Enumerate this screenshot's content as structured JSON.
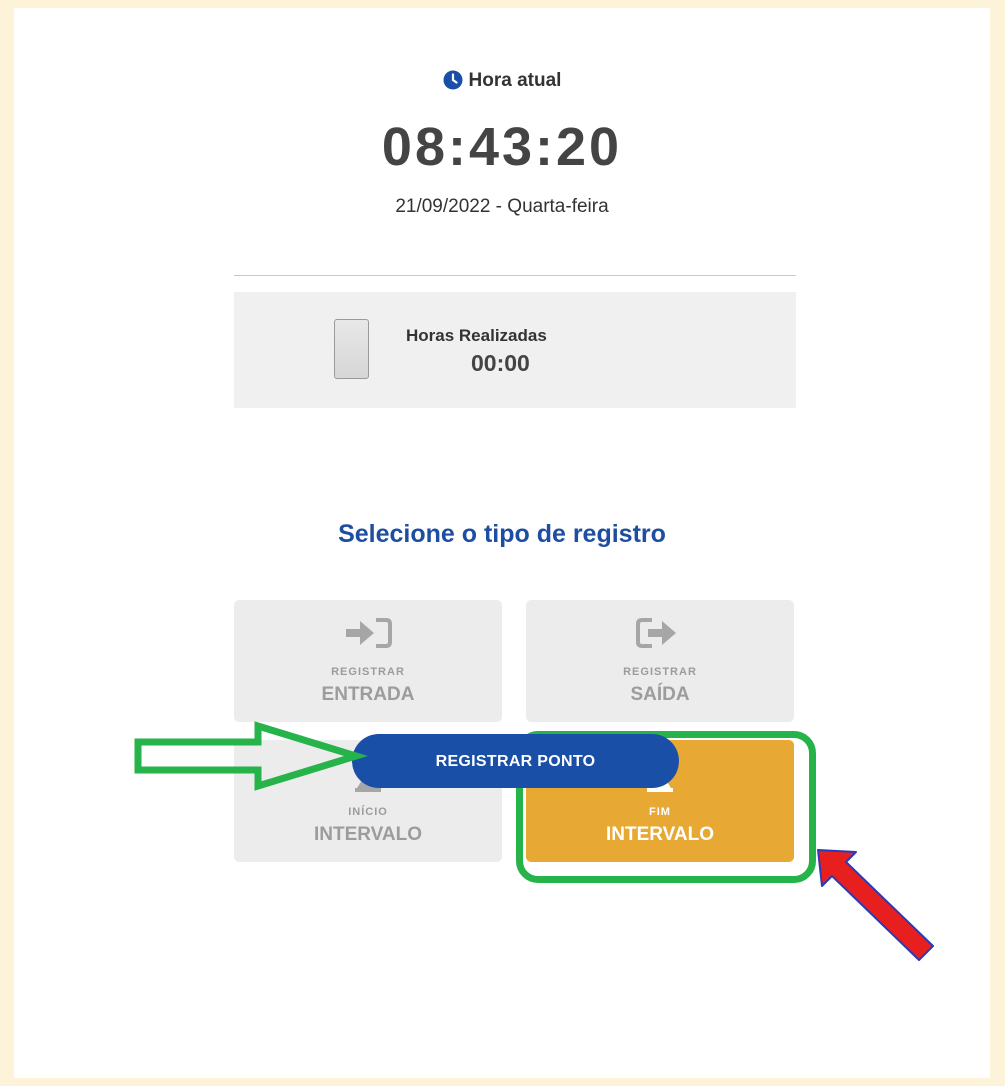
{
  "clock": {
    "label": "Hora atual",
    "time": "08:43:20",
    "date": "21/09/2022 - Quarta-feira",
    "icon": "clock-icon"
  },
  "hours": {
    "label": "Horas Realizadas",
    "value": "00:00",
    "icon": "phone-icon"
  },
  "select_title": "Selecione o tipo de registro",
  "tiles": [
    {
      "small": "REGISTRAR",
      "big": "ENTRADA",
      "icon": "sign-in-icon",
      "active": false
    },
    {
      "small": "REGISTRAR",
      "big": "SAÍDA",
      "icon": "sign-out-icon",
      "active": false
    },
    {
      "small": "INÍCIO",
      "big": "INTERVALO",
      "icon": "hourglass-start-icon",
      "active": false
    },
    {
      "small": "FIM",
      "big": "INTERVALO",
      "icon": "hourglass-end-icon",
      "active": true
    }
  ],
  "submit_label": "REGISTRAR PONTO",
  "colors": {
    "background": "#fdf3d9",
    "accent_blue": "#1a4fa8",
    "tile_active": "#e8a934",
    "tile_inactive": "#ececec",
    "highlight_green": "#25b34a",
    "arrow_red": "#e81f1f"
  }
}
